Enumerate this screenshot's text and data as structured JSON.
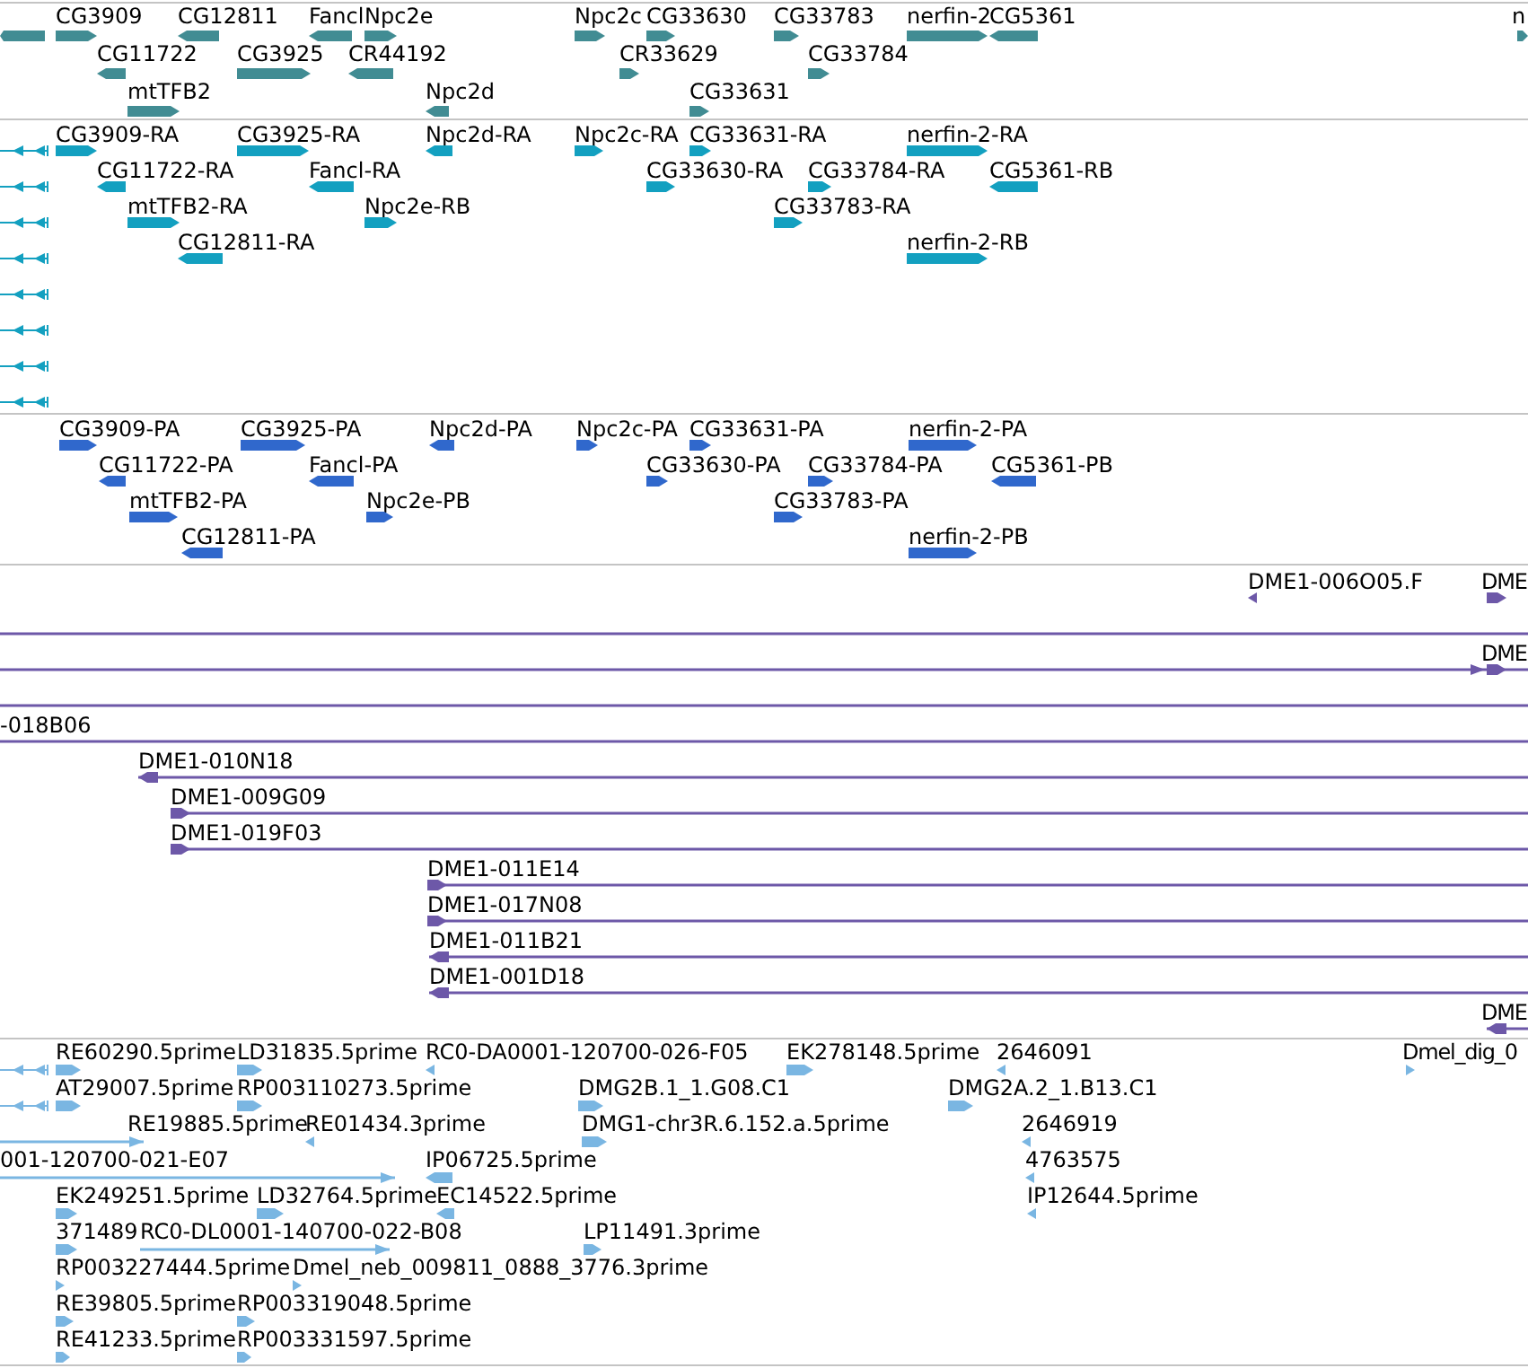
{
  "tracks": [
    {
      "color": "#418c93",
      "features": [
        {
          "reverse": true
        },
        {
          "label": "CG3909",
          "reverse": false
        },
        {
          "label": "CG12811",
          "reverse": true
        },
        {
          "label": "Fancl",
          "reverse": true
        },
        {
          "label": "Npc2e",
          "reverse": false
        },
        {
          "label": "Npc2c",
          "reverse": false
        },
        {
          "label": "CG33630",
          "reverse": false
        },
        {
          "label": "CG33783",
          "reverse": false
        },
        {
          "label": "nerfin-2",
          "reverse": false
        },
        {
          "label": "CG5361",
          "reverse": true
        },
        {
          "label": "n",
          "reverse": false
        },
        {
          "label": "CG11722",
          "reverse": true
        },
        {
          "label": "CG3925",
          "reverse": false
        },
        {
          "label": "CR44192",
          "reverse": true
        },
        {
          "label": "CR33629",
          "reverse": false
        },
        {
          "label": "CG33784",
          "reverse": false
        },
        {
          "label": "mtTFB2",
          "reverse": false
        },
        {
          "label": "Npc2d",
          "reverse": true
        },
        {
          "label": "CG33631",
          "reverse": false
        }
      ]
    },
    {
      "color": "#13a0c0",
      "features": [
        {
          "reverse": true
        },
        {
          "label": "CG3909-RA",
          "reverse": false
        },
        {
          "label": "CG3925-RA",
          "reverse": false
        },
        {
          "label": "Npc2d-RA",
          "reverse": true
        },
        {
          "label": "Npc2c-RA",
          "reverse": false
        },
        {
          "label": "CG33631-RA",
          "reverse": false
        },
        {
          "label": "nerfin-2-RA",
          "reverse": false
        },
        {
          "reverse": true
        },
        {
          "label": "CG11722-RA",
          "reverse": true
        },
        {
          "label": "Fancl-RA",
          "reverse": true
        },
        {
          "label": "CG33630-RA",
          "reverse": false
        },
        {
          "label": "CG33784-RA",
          "reverse": false
        },
        {
          "label": "CG5361-RB",
          "reverse": true
        },
        {
          "reverse": true
        },
        {
          "label": "mtTFB2-RA",
          "reverse": false
        },
        {
          "label": "Npc2e-RB",
          "reverse": false
        },
        {
          "label": "CG33783-RA",
          "reverse": false
        },
        {
          "reverse": true
        },
        {
          "label": "CG12811-RA",
          "reverse": true
        },
        {
          "label": "nerfin-2-RB",
          "reverse": false
        },
        {
          "reverse": true
        },
        {
          "reverse": true
        },
        {
          "reverse": true
        },
        {
          "reverse": true
        }
      ]
    },
    {
      "color": "#3068cc",
      "features": [
        {
          "label": "CG3909-PA",
          "reverse": false
        },
        {
          "label": "CG3925-PA",
          "reverse": false
        },
        {
          "label": "Npc2d-PA",
          "reverse": true
        },
        {
          "label": "Npc2c-PA",
          "reverse": false
        },
        {
          "label": "CG33631-PA",
          "reverse": false
        },
        {
          "label": "nerfin-2-PA",
          "reverse": false
        },
        {
          "label": "CG11722-PA",
          "reverse": true
        },
        {
          "label": "Fancl-PA",
          "reverse": true
        },
        {
          "label": "CG33630-PA",
          "reverse": false
        },
        {
          "label": "CG33784-PA",
          "reverse": false
        },
        {
          "label": "CG5361-PB",
          "reverse": true
        },
        {
          "label": "mtTFB2-PA",
          "reverse": false
        },
        {
          "label": "Npc2e-PB",
          "reverse": false
        },
        {
          "label": "CG33783-PA",
          "reverse": false
        },
        {
          "label": "CG12811-PA",
          "reverse": true
        },
        {
          "label": "nerfin-2-PB",
          "reverse": false
        }
      ]
    },
    {
      "color": "#6d58a8",
      "features": [
        {
          "label": "DME1-006O05.F",
          "reverse": true
        },
        {
          "label": "DME",
          "reverse": false
        },
        {
          "reverse": false
        },
        {
          "label": "DME",
          "reverse": false
        },
        {
          "reverse": false
        },
        {
          "label": "-018B06",
          "reverse": false
        },
        {
          "label": "DME1-010N18",
          "reverse": true
        },
        {
          "label": "DME1-009G09",
          "reverse": false
        },
        {
          "label": "DME1-019F03",
          "reverse": false
        },
        {
          "label": "DME1-011E14",
          "reverse": false
        },
        {
          "label": "DME1-017N08",
          "reverse": false
        },
        {
          "label": "DME1-011B21",
          "reverse": true
        },
        {
          "label": "DME1-001D18",
          "reverse": true
        },
        {
          "label": "DME",
          "reverse": true
        }
      ]
    },
    {
      "color": "#7ab6e2",
      "features": [
        {
          "reverse": true
        },
        {
          "label": "RE60290.5prime",
          "reverse": false
        },
        {
          "label": "LD31835.5prime",
          "reverse": false
        },
        {
          "label": "RC0-DA0001-120700-026-F05",
          "reverse": true
        },
        {
          "label": "EK278148.5prime",
          "reverse": false
        },
        {
          "label": "2646091",
          "reverse": true
        },
        {
          "label": "Dmel_dig_0",
          "reverse": false
        },
        {
          "reverse": true
        },
        {
          "label": "AT29007.5prime",
          "reverse": false
        },
        {
          "label": "RP003110273.5prime",
          "reverse": false
        },
        {
          "label": "DMG2B.1_1.G08.C1",
          "reverse": false
        },
        {
          "label": "DMG2A.2_1.B13.C1",
          "reverse": false
        },
        {
          "label": "RE19885.5prime",
          "reverse": false
        },
        {
          "label": "RE01434.3prime",
          "reverse": true
        },
        {
          "label": "DMG1-chr3R.6.152.a.5prime",
          "reverse": false
        },
        {
          "label": "2646919",
          "reverse": true
        },
        {
          "label": "001-120700-021-E07",
          "reverse": false
        },
        {
          "label": "IP06725.5prime",
          "reverse": true
        },
        {
          "label": "4763575",
          "reverse": true
        },
        {
          "label": "EK249251.5prime",
          "reverse": false
        },
        {
          "label": "LD32764.5prime",
          "reverse": false
        },
        {
          "label": "EC14522.5prime",
          "reverse": true
        },
        {
          "label": "IP12644.5prime",
          "reverse": true
        },
        {
          "label": "371489",
          "reverse": false
        },
        {
          "label": "RC0-DL0001-140700-022-B08",
          "reverse": false
        },
        {
          "label": "LP11491.3prime",
          "reverse": false
        },
        {
          "label": "RP003227444.5prime",
          "reverse": false
        },
        {
          "label": "Dmel_neb_009811_0888_3776.3prime",
          "reverse": false
        },
        {
          "label": "RE39805.5prime",
          "reverse": false
        },
        {
          "label": "RP003319048.5prime",
          "reverse": false
        },
        {
          "label": "RE41233.5prime",
          "reverse": false
        },
        {
          "label": "RP003331597.5prime",
          "reverse": false
        }
      ]
    }
  ]
}
